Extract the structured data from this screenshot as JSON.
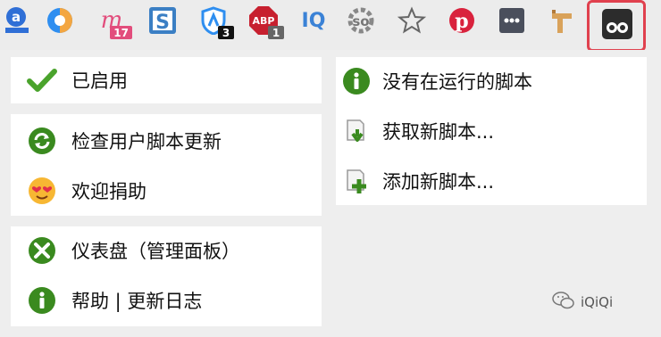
{
  "toolbar": {
    "badges": {
      "m_count": "17",
      "shield_count": "3",
      "abp_count": "1"
    },
    "icon_text": {
      "iq": "IQ",
      "abp": "ABP"
    }
  },
  "menu": {
    "enabled_label": "已启用",
    "check_updates_label": "检查用户脚本更新",
    "donate_label": "欢迎捐助",
    "dashboard_label": "仪表盘（管理面板）",
    "help_label": "帮助 | 更新日志",
    "no_scripts_label": "没有在运行的脚本",
    "get_scripts_label": "获取新脚本...",
    "add_script_label": "添加新脚本..."
  },
  "watermark": {
    "text": "iQiQi"
  },
  "colors": {
    "highlight": "#e0414e",
    "green": "#3a8a1f",
    "panel": "#ffffff",
    "background": "#eeeeee"
  }
}
